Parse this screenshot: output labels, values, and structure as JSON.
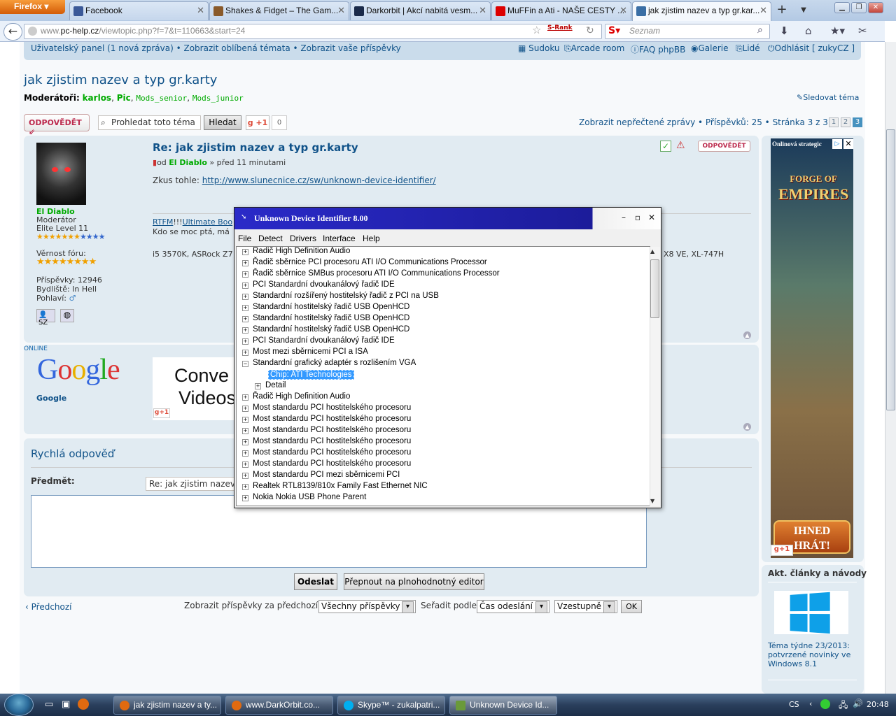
{
  "browser": {
    "app_button": "Firefox",
    "tabs": [
      {
        "label": "Facebook",
        "color": "#3b5998"
      },
      {
        "label": "Shakes & Fidget – The Gam...",
        "color": "#8a5a2a"
      },
      {
        "label": "Darkorbit | Akcí nabitá vesm...",
        "color": "#1a2a4a"
      },
      {
        "label": "MuFFin a Ati - NAŠE CESTY ...",
        "color": "#d00"
      },
      {
        "label": "jak zjistim nazev a typ gr.kar...",
        "color": "#3a6ea5"
      }
    ],
    "url_gray": "www.",
    "url_domain": "pc-help.cz",
    "url_path": "/viewtopic.php?f=7&t=110663&start=24",
    "srank": "S-Rank",
    "search_placeholder": "Seznam"
  },
  "forum": {
    "topnav_left": "Uživatelský panel (1 nová zpráva) • Zobrazit oblíbená témata • Zobrazit vaše příspěvky",
    "topnav_right": [
      "Sudoku",
      "Arcade room",
      "FAQ phpBB",
      "Galerie",
      "Lidé",
      "Odhlásit [ zukyCZ ]"
    ],
    "title": "jak zjistim nazev a typ gr.karty",
    "mods_label": "Moderátoři:",
    "mods_bold": [
      "karlos",
      "Pic"
    ],
    "mods_other": [
      "Mods_senior",
      "Mods_junior"
    ],
    "watch": "Sledovat téma",
    "reply_btn": "ODPOVĚDĚT",
    "search_ph": "Prohledat toto téma",
    "search_btn": "Hledat",
    "gplus": "+1",
    "gcount": "0",
    "pagination_pre": "Zobrazit nepřečtené zprávy • Příspěvků: 25 •",
    "pagination_link": "Stránka 3 z 3",
    "pages": [
      "1",
      "2",
      "3"
    ],
    "current_page": "3"
  },
  "post": {
    "author": "El Diablo",
    "rank": "Moderátor",
    "level": "Elite Level 11",
    "loyalty_label": "Věrnost fóru:",
    "posts": "Příspěvky: 12946",
    "lives": "Bydliště: In Hell",
    "gender": "Pohlaví:",
    "title": "Re: jak zjistim nazev a typ gr.karty",
    "by_prefix": "od",
    "by_suffix": "» před 11 minutami",
    "body_prefix": "Zkus tohle:",
    "body_link": "http://www.slunecnice.cz/sw/unknown-device-identifier/",
    "sig1_a": "RTFM",
    "sig1_b": "!!!",
    "sig1_c": "Ultimate Boo",
    "sig2": "Kdo se moc ptá, má",
    "sig3": "i5 3570K, ASRock Z7",
    "sig4": "X8 VE, XL-747H",
    "quote_btn": "ODPOVĚDĚT",
    "stars_orange": 7,
    "stars_blue": 4,
    "loyalty_stars": 8
  },
  "ad_post": {
    "online": "ONLINE",
    "google": "Google",
    "google_name": "Google",
    "convert_l1": "Conve",
    "convert_l2": "Videos",
    "gplus": "+1"
  },
  "quick_reply": {
    "title": "Rychlá odpověď",
    "subject_label": "Předmět:",
    "subject_value": "Re: jak zjistim nazev a typ gr.karty",
    "send": "Odeslat",
    "full_editor": "Přepnout na plnohodnotný editor"
  },
  "bottom": {
    "prev": "Předchozí",
    "filter_label": "Zobrazit příspěvky za předchozí:",
    "filter_value": "Všechny příspěvky",
    "sort_label": "Seřadit podle",
    "sort_value": "Čas odeslání",
    "order_value": "Vzestupně",
    "ok": "OK"
  },
  "sidebar": {
    "ad_label": "Onlinová strategic",
    "ad_title_1": "FORGE OF",
    "ad_title_2": "EMPIRES",
    "ad_cta_1": "IHNED",
    "ad_cta_2": "HRÁT!",
    "gplus": "+1",
    "articles_title": "Akt. články a návody",
    "article_text": "Téma týdne 23/2013: potvrzené novinky ve Windows 8.1"
  },
  "dialog": {
    "title": "Unknown Device Identifier 8.00",
    "menu": [
      "File",
      "Detect",
      "Drivers",
      "Interface",
      "Help"
    ],
    "tree": [
      {
        "label": "Řadič High Definition Audio",
        "level": 0,
        "box": "+"
      },
      {
        "label": "Řadič sběrnice PCI procesoru ATI I/O Communications Processor",
        "level": 0,
        "box": "+"
      },
      {
        "label": "Řadič sběrnice SMBus procesoru ATI I/O Communications Processor",
        "level": 0,
        "box": "+"
      },
      {
        "label": "PCI Standardní dvoukanálový řadič IDE",
        "level": 0,
        "box": "+"
      },
      {
        "label": "Standardní rozšířený hostitelský řadič z PCI na USB",
        "level": 0,
        "box": "+"
      },
      {
        "label": "Standardní hostitelský řadič  USB OpenHCD",
        "level": 0,
        "box": "+"
      },
      {
        "label": "Standardní hostitelský řadič  USB OpenHCD",
        "level": 0,
        "box": "+"
      },
      {
        "label": "Standardní hostitelský řadič  USB OpenHCD",
        "level": 0,
        "box": "+"
      },
      {
        "label": "PCI Standardní dvoukanálový řadič IDE",
        "level": 0,
        "box": "+"
      },
      {
        "label": "Most mezi sběrnicemi PCI a ISA",
        "level": 0,
        "box": "+"
      },
      {
        "label": "Standardní grafický adaptér s rozlišením VGA",
        "level": 0,
        "box": "−"
      },
      {
        "label": "Chip: ATI Technologies",
        "level": 1,
        "box": "",
        "selected": true
      },
      {
        "label": "Detail",
        "level": 1,
        "box": "+"
      },
      {
        "label": "Řadič High Definition Audio",
        "level": 0,
        "box": "+"
      },
      {
        "label": "Most standardu PCI hostitelského procesoru",
        "level": 0,
        "box": "+"
      },
      {
        "label": "Most standardu PCI hostitelského procesoru",
        "level": 0,
        "box": "+"
      },
      {
        "label": "Most standardu PCI hostitelského procesoru",
        "level": 0,
        "box": "+"
      },
      {
        "label": "Most standardu PCI hostitelského procesoru",
        "level": 0,
        "box": "+"
      },
      {
        "label": "Most standardu PCI hostitelského procesoru",
        "level": 0,
        "box": "+"
      },
      {
        "label": "Most standardu PCI hostitelského procesoru",
        "level": 0,
        "box": "+"
      },
      {
        "label": "Most standardu PCI mezi sběrnicemi PCI",
        "level": 0,
        "box": "+"
      },
      {
        "label": "Realtek RTL8139/810x Family Fast Ethernet NIC",
        "level": 0,
        "box": "+"
      },
      {
        "label": "Nokia Nokia USB Phone Parent",
        "level": 0,
        "box": "+"
      }
    ]
  },
  "taskbar": {
    "items": [
      {
        "label": "jak zjistim nazev a ty...",
        "color": "#e06a10"
      },
      {
        "label": "www.DarkOrbit.co...",
        "color": "#e06a10"
      },
      {
        "label": "Skype™ - zukalpatri...",
        "color": "#00aff0"
      },
      {
        "label": "Unknown Device Id...",
        "color": "#6a9a3a"
      }
    ],
    "lang": "CS",
    "time": "20:48"
  }
}
